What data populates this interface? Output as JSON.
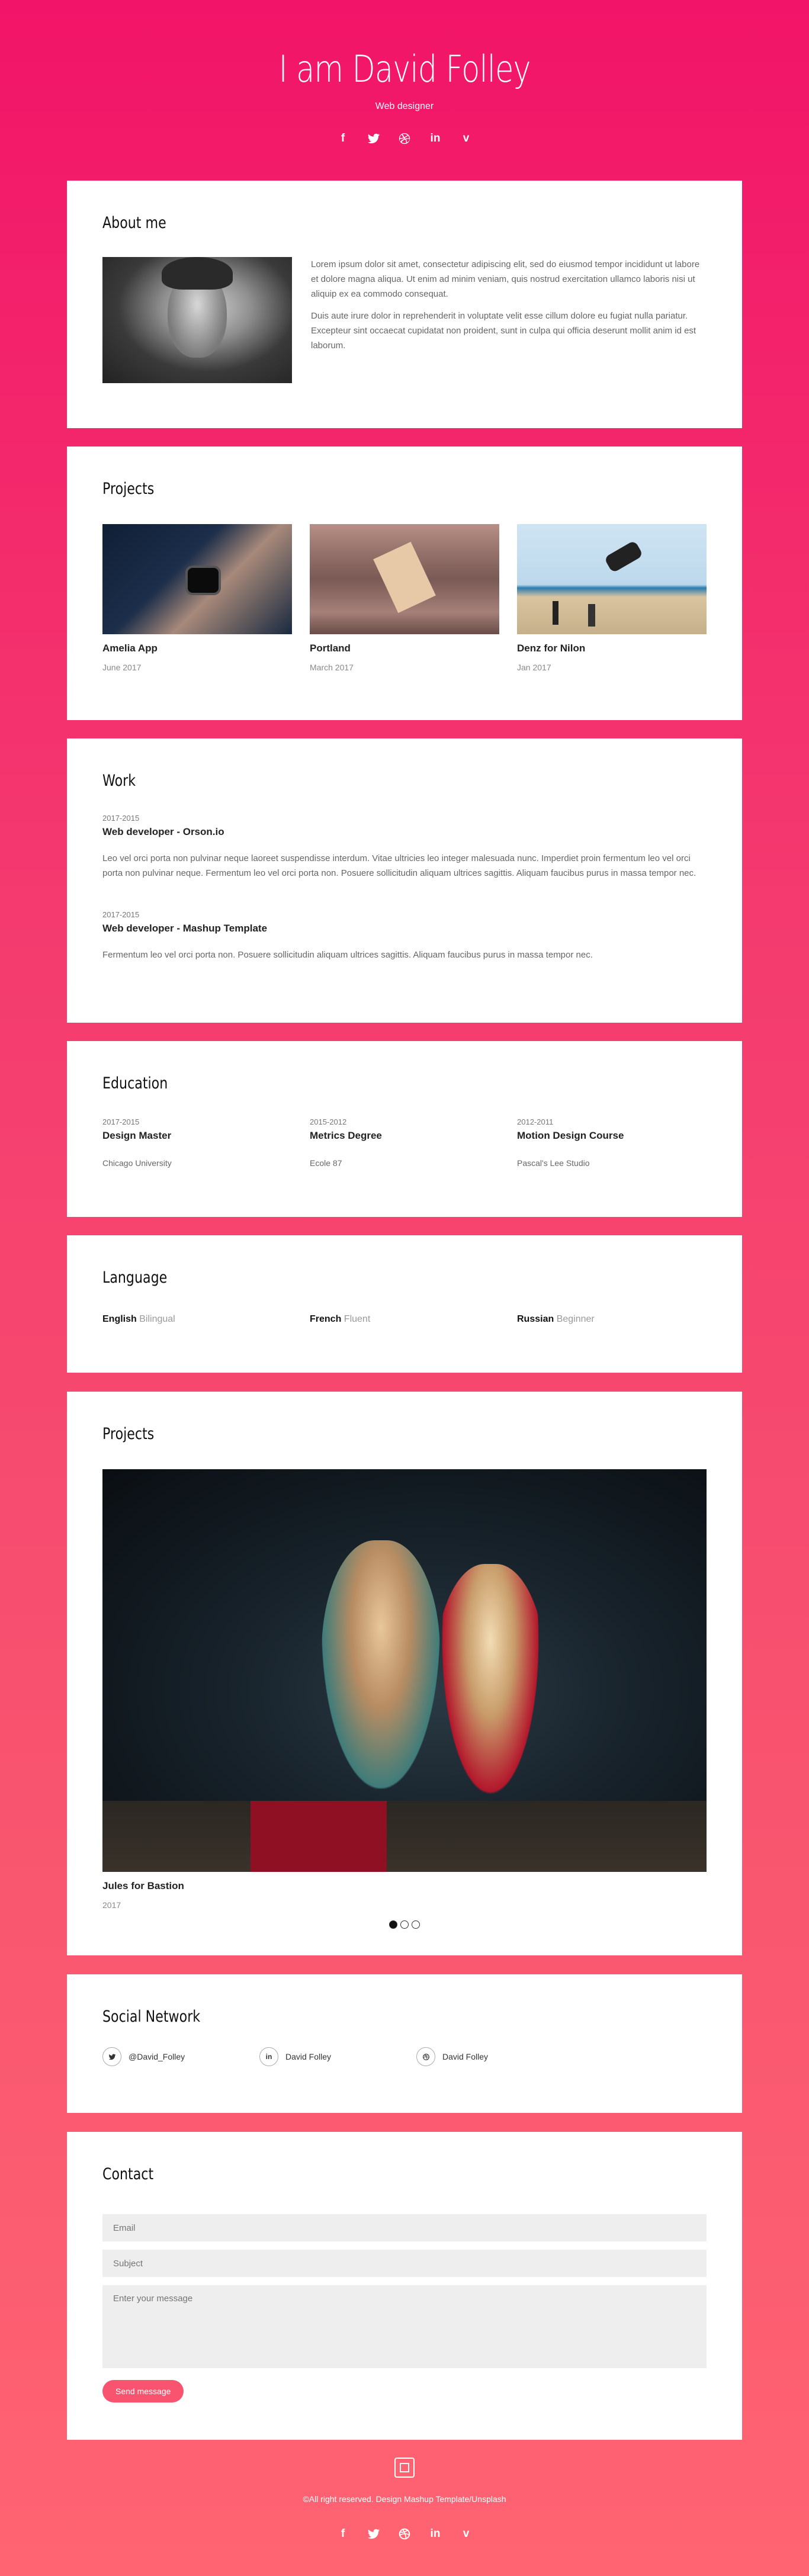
{
  "header": {
    "name": "I am David Folley",
    "role": "Web designer"
  },
  "social_icons": [
    "facebook-icon",
    "twitter-icon",
    "dribbble-icon",
    "linkedin-icon",
    "vimeo-icon"
  ],
  "about": {
    "title": "About me",
    "paragraphs": [
      "Lorem ipsum dolor sit amet, consectetur adipiscing elit, sed do eiusmod tempor incididunt ut labore et dolore magna aliqua. Ut enim ad minim veniam, quis nostrud exercitation ullamco laboris nisi ut aliquip ex ea commodo consequat.",
      "Duis aute irure dolor in reprehenderit in voluptate velit esse cillum dolore eu fugiat nulla pariatur. Excepteur sint occaecat cupidatat non proident, sunt in culpa qui officia deserunt mollit anim id est laborum."
    ]
  },
  "projects": {
    "title": "Projects",
    "items": [
      {
        "name": "Amelia App",
        "date": "June 2017"
      },
      {
        "name": "Portland",
        "date": "March 2017"
      },
      {
        "name": "Denz for Nilon",
        "date": "Jan 2017"
      }
    ]
  },
  "work": {
    "title": "Work",
    "items": [
      {
        "period": "2017-2015",
        "role": "Web developer - Orson.io",
        "desc": "Leo vel orci porta non pulvinar neque laoreet suspendisse interdum. Vitae ultricies leo integer malesuada nunc. Imperdiet proin fermentum leo vel orci porta non pulvinar neque. Fermentum leo vel orci porta non. Posuere sollicitudin aliquam ultrices sagittis. Aliquam faucibus purus in massa tempor nec."
      },
      {
        "period": "2017-2015",
        "role": "Web developer - Mashup Template",
        "desc": "Fermentum leo vel orci porta non. Posuere sollicitudin aliquam ultrices sagittis. Aliquam faucibus purus in massa tempor nec."
      }
    ]
  },
  "education": {
    "title": "Education",
    "items": [
      {
        "period": "2017-2015",
        "degree": "Design Master",
        "school": "Chicago University"
      },
      {
        "period": "2015-2012",
        "degree": "Metrics Degree",
        "school": "Ecole 87"
      },
      {
        "period": "2012-2011",
        "degree": "Motion Design Course",
        "school": "Pascal's Lee Studio"
      }
    ]
  },
  "language": {
    "title": "Language",
    "items": [
      {
        "name": "English",
        "level": "Bilingual"
      },
      {
        "name": "French",
        "level": "Fluent"
      },
      {
        "name": "Russian",
        "level": "Beginner"
      }
    ]
  },
  "slider": {
    "title": "Projects",
    "caption": "Jules for Bastion",
    "year": "2017",
    "slide_count": 3,
    "active_slide": 1
  },
  "social_network": {
    "title": "Social Network",
    "items": [
      {
        "icon": "twitter-icon",
        "label": "@David_Folley"
      },
      {
        "icon": "linkedin-icon",
        "label": "David Folley"
      },
      {
        "icon": "dribbble-icon",
        "label": "David Folley"
      }
    ]
  },
  "contact": {
    "title": "Contact",
    "email_placeholder": "Email",
    "subject_placeholder": "Subject",
    "message_placeholder": "Enter your message",
    "send_label": "Send message"
  },
  "footer": {
    "copyright": "©All right reserved. Design Mashup Template/Unsplash"
  },
  "colors": {
    "accent": "#f8546f",
    "gradient_top": "#f21468",
    "gradient_bottom": "#ff6472"
  }
}
